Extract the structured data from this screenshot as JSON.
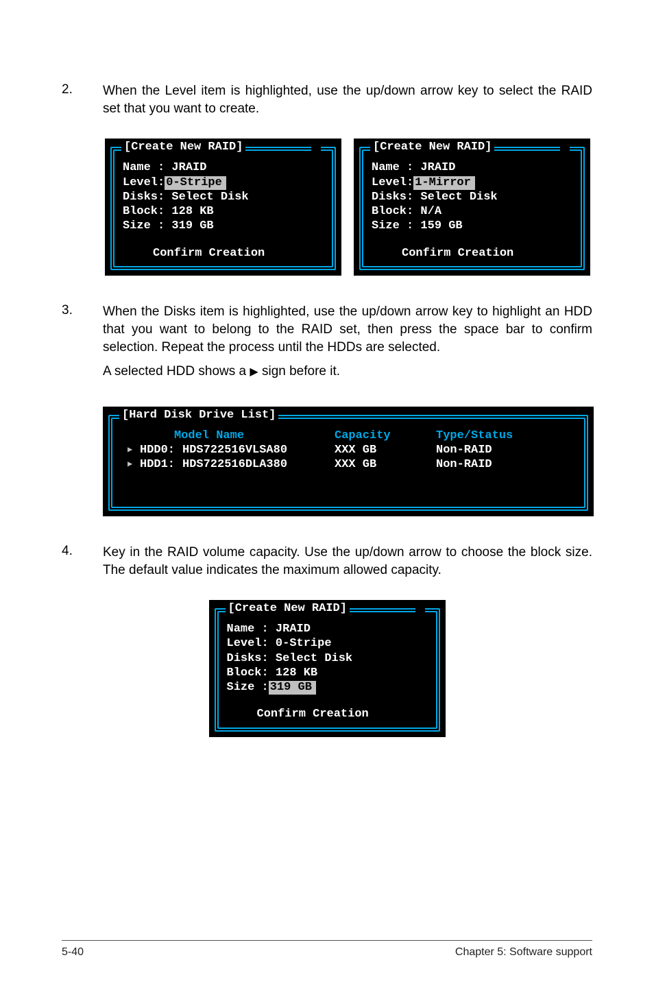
{
  "steps": {
    "s2": {
      "num": "2.",
      "text": "When the Level item is highlighted, use the up/down arrow key to select the RAID set that you want to create."
    },
    "s3": {
      "num": "3.",
      "text": "When the Disks item is highlighted, use the up/down arrow key to highlight an HDD that you want to belong to the RAID set, then press the space bar to confirm selection. Repeat the process until the HDDs are selected.",
      "note_a": "A selected HDD shows a ",
      "note_b": " sign before it."
    },
    "s4": {
      "num": "4.",
      "text": "Key in the RAID volume capacity. Use the up/down arrow to choose the block size. The default value indicates the maximum allowed capacity."
    }
  },
  "panelA": {
    "title": "[Create New RAID]",
    "name": "Name : JRAID",
    "level_label": "Level:",
    "level_value": "0-Stripe",
    "disks": "Disks: Select Disk",
    "block": "Block: 128 KB",
    "size": "Size : 319 GB",
    "confirm": "Confirm Creation"
  },
  "panelB": {
    "title": "[Create New RAID]",
    "name": "Name : JRAID",
    "level_label": "Level:",
    "level_value": "1-Mirror",
    "disks": "Disks: Select Disk",
    "block": "Block: N/A",
    "size": "Size : 159 GB",
    "confirm": "Confirm Creation"
  },
  "hdd": {
    "title": "[Hard Disk Drive List]",
    "header": {
      "model": "Model Name",
      "capacity": "Capacity",
      "type": "Type/Status"
    },
    "rows": [
      {
        "id": "HDD0:",
        "model": "HDS722516VLSA80",
        "capacity": "XXX GB",
        "type": "Non-RAID"
      },
      {
        "id": "HDD1:",
        "model": "HDS722516DLA380",
        "capacity": "XXX GB",
        "type": "Non-RAID"
      }
    ]
  },
  "panelC": {
    "title": "[Create New RAID]",
    "name": "Name : JRAID",
    "level": "Level: 0-Stripe",
    "disks": "Disks: Select Disk",
    "block": "Block: 128 KB",
    "size_label": "Size :",
    "size_value": "319 GB",
    "confirm": "Confirm Creation"
  },
  "footer": {
    "left": "5-40",
    "right": "Chapter 5: Software support"
  },
  "glyph": {
    "tri": "▶"
  }
}
